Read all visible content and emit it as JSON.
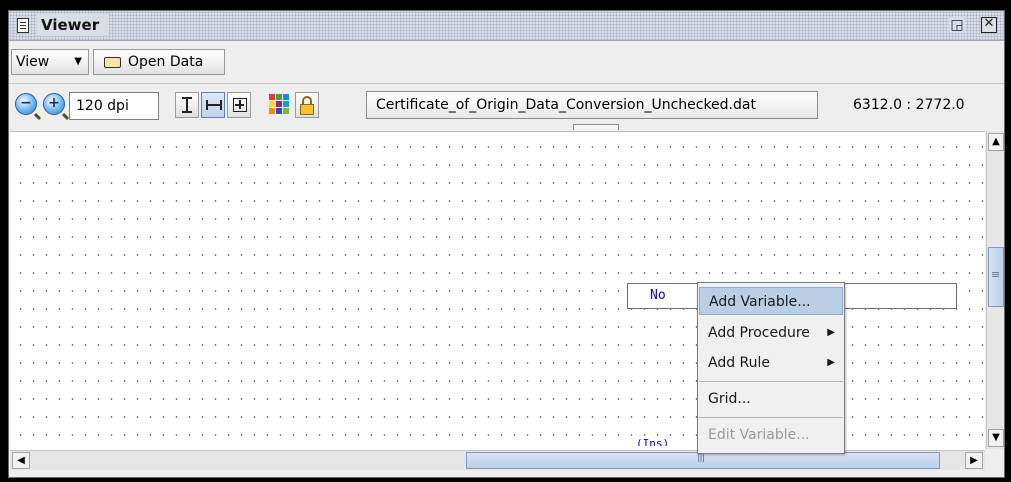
{
  "window": {
    "title": "Viewer",
    "restore_glyph": "◲",
    "close_glyph": "✕"
  },
  "menubar": {
    "view_label": "View",
    "open_data_label": "Open Data"
  },
  "toolbar": {
    "zoom_out_glyph": "−",
    "zoom_in_glyph": "+",
    "dpi_value": "120 dpi",
    "filename": "Certificate_of_Origin_Data_Conversion_Unchecked.dat",
    "coordinates": "6312.0 : 2772.0",
    "palette_colors": [
      "#e53935",
      "#43a047",
      "#1e88e5",
      "#fdd835",
      "#8e24aa",
      "#00acc1",
      "#fb8c00",
      "#3949ab",
      "#7cb342"
    ]
  },
  "canvas": {
    "field_value": "No",
    "partial_label": "(Ins)"
  },
  "context_menu": {
    "items": [
      {
        "label": "Add Variable...",
        "highlighted": true,
        "enabled": true
      },
      {
        "label": "Add Procedure",
        "submenu": true,
        "enabled": true
      },
      {
        "label": "Add Rule",
        "submenu": true,
        "enabled": true
      },
      {
        "label": "Grid...",
        "enabled": true
      },
      {
        "label": "Edit Variable...",
        "enabled": false
      }
    ],
    "submenu_glyph": "▶"
  },
  "colors": {
    "accent": "#b8cfe5",
    "value_text": "#0000cc"
  }
}
